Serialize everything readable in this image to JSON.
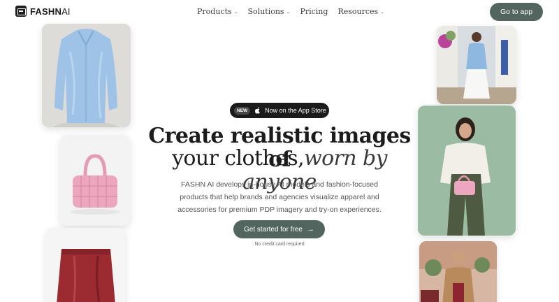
{
  "brand": {
    "name_bold": "FASHN",
    "name_light": "AI"
  },
  "nav": {
    "items": [
      {
        "label": "Products",
        "has_menu": true
      },
      {
        "label": "Solutions",
        "has_menu": true
      },
      {
        "label": "Pricing",
        "has_menu": false
      },
      {
        "label": "Resources",
        "has_menu": true
      }
    ],
    "app_button": "Go to app"
  },
  "hero": {
    "badge_tag": "NEW",
    "badge_text": "Now on the App Store",
    "headline_line1": "Create realistic images of",
    "headline_line2_plain": "your clothes,",
    "headline_line2_italic": "worn by anyone",
    "description": "FASHN AI develops in-house AI models and fashion-focused products that help brands and agencies visualize apparel and accessories for premium PDP imagery and try-on experiences.",
    "cta_label": "Get started for free",
    "cta_note": "No credit card required"
  },
  "gallery": {
    "left": [
      "blue-satin-shirt",
      "pink-woven-handbag",
      "red-leather-skirt"
    ],
    "right": [
      "model-street-blue-shirt",
      "model-green-backdrop",
      "model-cafe-camel-coat"
    ]
  },
  "colors": {
    "accent": "#53655f",
    "badge_bg": "#1b1b1b",
    "text": "#1c1c1c"
  }
}
